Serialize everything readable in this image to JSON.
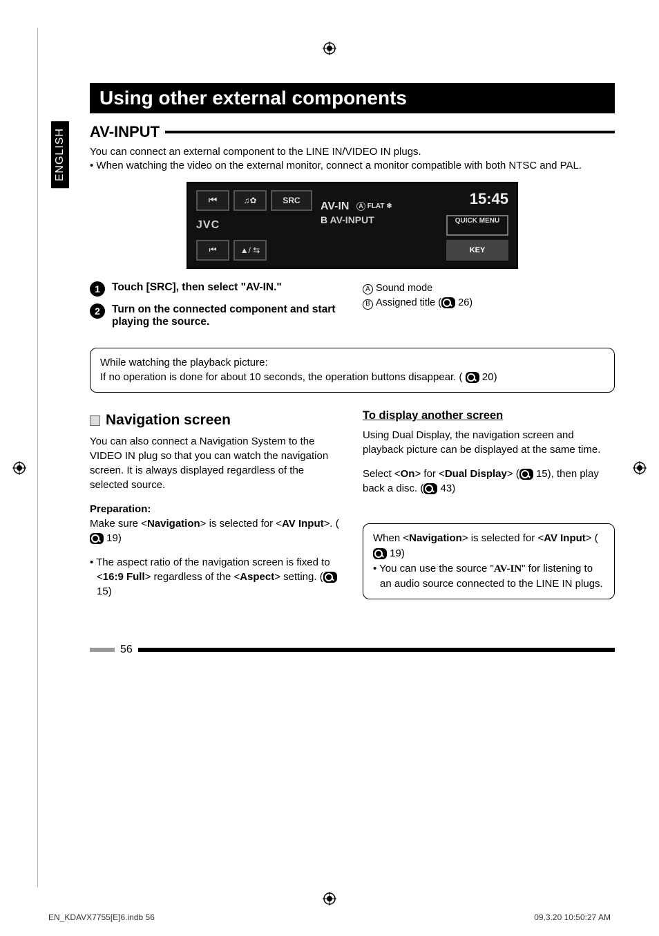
{
  "sideTab": "ENGLISH",
  "title": "Using other external components",
  "section1": {
    "heading": "AV-INPUT",
    "intro": "You can connect an external component to the LINE IN/VIDEO IN plugs.",
    "bullet": "•  When watching the video on the external monitor, connect a monitor compatible with both NTSC and PAL."
  },
  "device": {
    "logo": "JVC",
    "src": "SRC",
    "line1": "AV-IN",
    "line1tagA": "A",
    "line1tagText": "FLAT",
    "line2prefix": "B",
    "line2": "AV-INPUT",
    "clock": "15:45",
    "quick": "QUICK\nMENU",
    "key": "KEY",
    "prev": "⏮",
    "music": "♫✿",
    "prev2": "⏮",
    "eject": "▲/ ⇆"
  },
  "steps": {
    "s1": "Touch [SRC], then select \"AV-IN.\"",
    "s2": "Turn on the connected component and start playing the source."
  },
  "legend": {
    "a": "Sound mode",
    "b_pre": "Assigned title (",
    "b_ref": "26",
    "b_post": ")"
  },
  "noteBox": {
    "l1": "While watching the playback picture:",
    "l2_pre": "If no operation is done for about 10 seconds, the operation buttons disappear. ( ",
    "l2_ref": "20",
    "l2_post": ")"
  },
  "nav": {
    "heading": "Navigation screen",
    "p1": "You can also connect a Navigation System to the VIDEO IN plug so that you can watch the navigation screen. It is always displayed regardless of the selected source.",
    "prepLabel": "Preparation:",
    "prep_pre": "Make sure <",
    "prep_b1": "Navigation",
    "prep_mid": "> is selected for <",
    "prep_b2": "AV Input",
    "prep_post": ">. (",
    "prep_ref": "19",
    "prep_end": ")",
    "aspect_pre": "•  The aspect ratio of the navigation screen is fixed to <",
    "aspect_b1": "16:9 Full",
    "aspect_mid": "> regardless of the <",
    "aspect_b2": "Aspect",
    "aspect_post": "> setting. (",
    "aspect_ref": "15",
    "aspect_end": ")"
  },
  "right": {
    "heading": "To display another screen",
    "p1": "Using Dual Display, the navigation screen and playback picture can be displayed at the same time.",
    "p2_pre": "Select <",
    "p2_b1": "On",
    "p2_mid": "> for <",
    "p2_b2": "Dual Display",
    "p2_post": "> (",
    "p2_ref": "15",
    "p2_mid2": "), then play back a disc. (",
    "p2_ref2": "43",
    "p2_end": ")",
    "box_pre": "When <",
    "box_b1": "Navigation",
    "box_mid": "> is selected for <",
    "box_b2": "AV Input",
    "box_post": "> (",
    "box_ref": "19",
    "box_end": ")",
    "box_bullet_pre": "•  You can use the source \"",
    "box_bullet_b": "AV-IN",
    "box_bullet_post": "\" for listening to an audio source connected to the LINE IN plugs."
  },
  "pageNumber": "56",
  "footer": {
    "left": "EN_KDAVX7755[E]6.indb   56",
    "right": "09.3.20   10:50:27 AM"
  }
}
